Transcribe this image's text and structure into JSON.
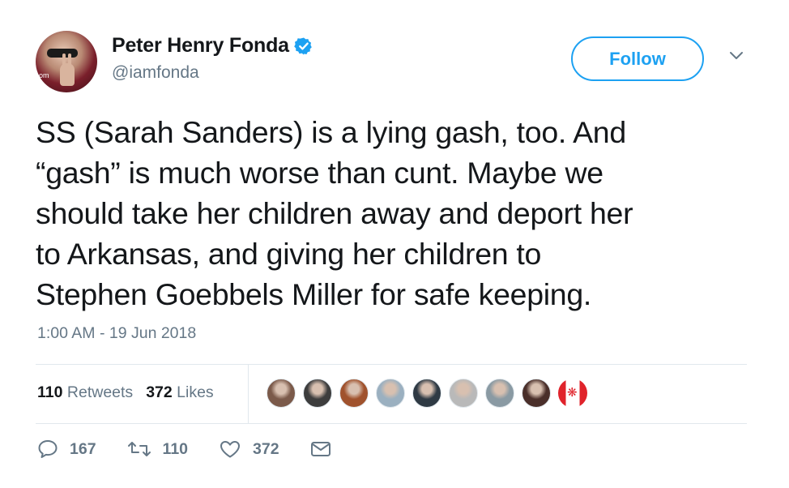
{
  "user": {
    "display_name": "Peter Henry Fonda",
    "handle": "@iamfonda",
    "avatar_tag": "om"
  },
  "follow_button": {
    "label": "Follow"
  },
  "tweet": {
    "lines": [
      "SS (Sarah Sanders) is a lying gash, too. And",
      "“gash” is much worse than cunt. Maybe we",
      "should take her children away and deport her",
      "to Arkansas, and giving her children to",
      "Stephen Goebbels Miller for safe keeping."
    ],
    "timestamp": "1:00 AM - 19 Jun 2018"
  },
  "stats": {
    "retweets_count": "110",
    "retweets_label": "Retweets",
    "likes_count": "372",
    "likes_label": "Likes"
  },
  "likers": [
    "#7b5a4a",
    "#3d3d3d",
    "#a0522d",
    "#9bb0c0",
    "#2f3a44",
    "#b9b9b9",
    "#8a9aa3",
    "#4a2f2a"
  ],
  "actions": {
    "replies": "167",
    "retweets": "110",
    "likes": "372"
  },
  "colors": {
    "accent": "#1da1f2",
    "text": "#14171a",
    "muted": "#657786",
    "border": "#e1e8ed"
  }
}
